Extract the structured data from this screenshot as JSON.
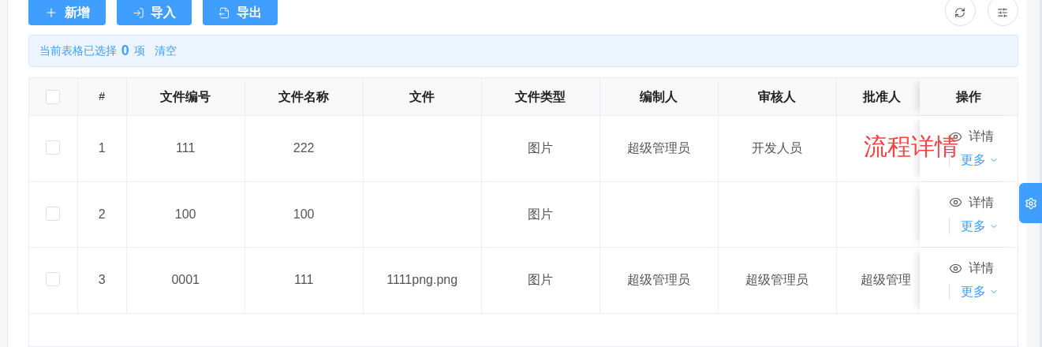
{
  "toolbar": {
    "buttons": [
      {
        "kind": "add",
        "label": "新增"
      },
      {
        "kind": "import",
        "label": "导入"
      },
      {
        "kind": "export",
        "label": "导出"
      }
    ]
  },
  "selection_alert": {
    "prefix": "当前表格已选择",
    "count": "0",
    "suffix": "项",
    "clear": "清空"
  },
  "table": {
    "select_all_checked": false,
    "columns": [
      "#",
      "文件编号",
      "文件名称",
      "文件",
      "文件类型",
      "编制人",
      "审核人",
      "批准人",
      "操作"
    ],
    "rows": [
      {
        "checked": false,
        "index": "1",
        "file_no": "111",
        "file_name": "222",
        "file_type": "图片",
        "author": "超级管理员",
        "reviewer": "开发人员",
        "detail": "详情",
        "more": "更多"
      },
      {
        "checked": false,
        "index": "2",
        "file_no": "100",
        "file_name": "100",
        "file_type": "图片",
        "detail": "详情",
        "more": "更多"
      },
      {
        "checked": false,
        "index": "3",
        "file_no": "0001",
        "file_name": "111",
        "file": "1111png.png",
        "file_type": "图片",
        "author": "超级管理员",
        "reviewer": "超级管理员",
        "approver": "超级管理",
        "detail": "详情",
        "more": "更多"
      }
    ]
  },
  "overlay_text": "流程详情"
}
